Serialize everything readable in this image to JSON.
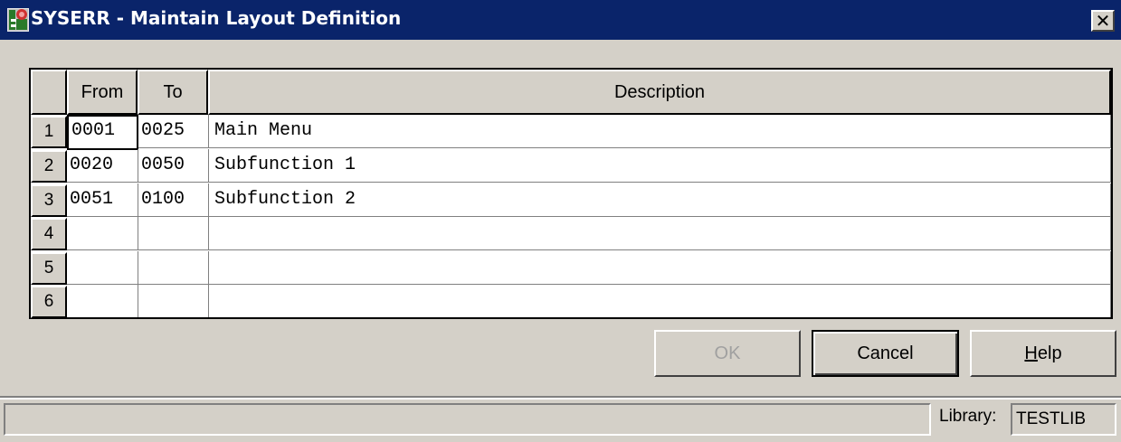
{
  "window": {
    "title": "SYSERR - Maintain Layout Definition",
    "close_symbol": "✕"
  },
  "grid": {
    "columns": [
      "From",
      "To",
      "Description"
    ],
    "row_numbers": [
      "1",
      "2",
      "3",
      "4",
      "5",
      "6"
    ],
    "rows": [
      {
        "from": "0001",
        "to": "0025",
        "description": "Main Menu"
      },
      {
        "from": "0020",
        "to": "0050",
        "description": "Subfunction 1"
      },
      {
        "from": "0051",
        "to": "0100",
        "description": "Subfunction 2"
      },
      {
        "from": "",
        "to": "",
        "description": ""
      },
      {
        "from": "",
        "to": "",
        "description": ""
      },
      {
        "from": "",
        "to": "",
        "description": ""
      }
    ]
  },
  "buttons": {
    "ok": "OK",
    "cancel": "Cancel",
    "help_mnemonic": "H",
    "help_rest": "elp"
  },
  "status": {
    "library_label": "Library:",
    "library_value": "TESTLIB"
  },
  "icons": {
    "app": "natural-app-icon",
    "close": "close-icon"
  },
  "colors": {
    "titlebar": "#0a246a",
    "face": "#d4d0c8"
  }
}
